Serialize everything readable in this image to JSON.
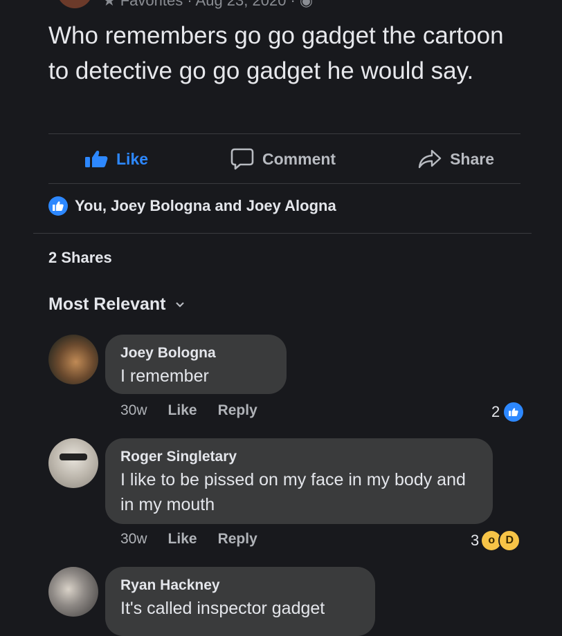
{
  "post": {
    "meta": "Favorites · Aug 23, 2020 ·",
    "text": "Who remembers go go gadget the cartoon to detective go go gadget he would say."
  },
  "actions": {
    "like": "Like",
    "comment": "Comment",
    "share": "Share"
  },
  "likes_summary": "You, Joey Bologna and Joey Alogna",
  "shares": "2 Shares",
  "sort_label": "Most Relevant",
  "comments": [
    {
      "name": "Joey Bologna",
      "text": "I remember",
      "time": "30w",
      "like": "Like",
      "reply": "Reply",
      "reaction_count": "2",
      "reactions": [
        "like-icon"
      ]
    },
    {
      "name": "Roger Singletary",
      "text": "I like to be pissed on my face in my body and in my mouth",
      "time": "30w",
      "like": "Like",
      "reply": "Reply",
      "reaction_count": "3",
      "reactions": [
        "wow-icon",
        "haha-icon"
      ]
    },
    {
      "name": "Ryan Hackney",
      "text": "It's called inspector gadget"
    }
  ],
  "colors": {
    "background": "#18191d",
    "bubble": "#3a3b3c",
    "accent": "#2d88ff",
    "reaction_yellow": "#f7c447"
  }
}
